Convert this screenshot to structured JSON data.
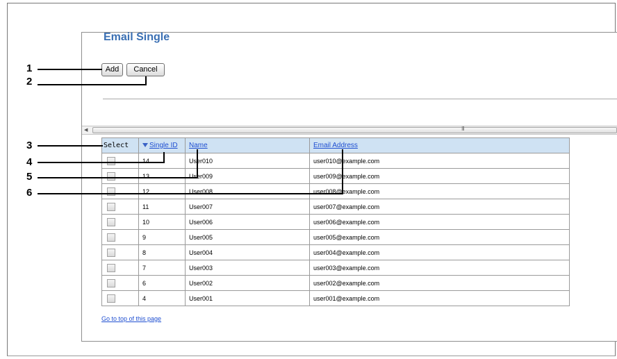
{
  "page": {
    "title": "Email Single"
  },
  "toolbar": {
    "add_label": "Add",
    "cancel_label": "Cancel"
  },
  "scrollbar": {
    "grip": "III"
  },
  "table": {
    "columns": [
      "Select",
      "Single ID",
      "Name",
      "Email Address"
    ],
    "rows": [
      {
        "id": "14",
        "name": "User010",
        "email": "user010@example.com"
      },
      {
        "id": "13",
        "name": "User009",
        "email": "user009@example.com"
      },
      {
        "id": "12",
        "name": "User008",
        "email": "user008@example.com"
      },
      {
        "id": "11",
        "name": "User007",
        "email": "user007@example.com"
      },
      {
        "id": "10",
        "name": "User006",
        "email": "user006@example.com"
      },
      {
        "id": "9",
        "name": "User005",
        "email": "user005@example.com"
      },
      {
        "id": "8",
        "name": "User004",
        "email": "user004@example.com"
      },
      {
        "id": "7",
        "name": "User003",
        "email": "user003@example.com"
      },
      {
        "id": "6",
        "name": "User002",
        "email": "user002@example.com"
      },
      {
        "id": "4",
        "name": "User001",
        "email": "user001@example.com"
      }
    ]
  },
  "footer": {
    "top_link": "Go to top of this page"
  },
  "callouts": [
    "1",
    "2",
    "3",
    "4",
    "5",
    "6"
  ]
}
